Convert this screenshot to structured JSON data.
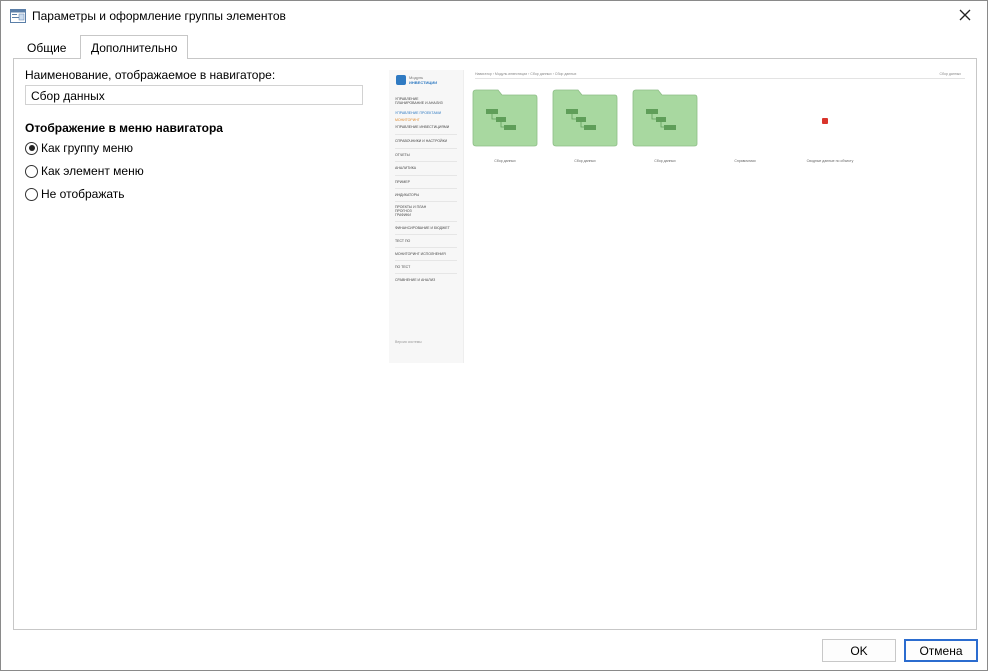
{
  "window": {
    "title": "Параметры и оформление группы элементов"
  },
  "tabs": [
    {
      "label": "Общие",
      "active": false
    },
    {
      "label": "Дополнительно",
      "active": true
    }
  ],
  "form": {
    "name_label": "Наименование, отображаемое в навигаторе:",
    "name_value": "Сбор данных",
    "section_title": "Отображение в меню навигатора",
    "options": [
      {
        "label": "Как группу меню",
        "checked": true
      },
      {
        "label": "Как элемент меню",
        "checked": false
      },
      {
        "label": "Не отображать",
        "checked": false
      }
    ]
  },
  "preview": {
    "logo_line1": "Модуль",
    "logo_line2": "ИНВЕСТИЦИИ",
    "sidebar_items": [
      "УПРАВЛЕНИЕ",
      "ПЛАНИРОВАНИЕ И АНАЛИЗ",
      "УПРАВЛЕНИЕ ПРОЕКТАМИ",
      "МОНИТОРИНГ",
      "УПРАВЛЕНИЕ ИНВЕСТИЦИЯМИ",
      "СПРАВОЧНИКИ И НАСТРОЙКИ",
      "ОТЧЕТЫ",
      "АНАЛИТИКА",
      "ПРИМЕР",
      "ИНДИКАТОРЫ",
      "ПРОЕКТЫ И ПЛАН",
      "ПРОГНОЗ",
      "ГРАФИКИ",
      "ФИНАНСИРОВАНИЕ И БЮДЖЕТ",
      "ТЕСТ ПО",
      "МОНИТОРИНГ ИСПОЛНЕНИЯ",
      "ПО ТЕСТ",
      "СРАВНЕНИЕ И АНАЛИЗ",
      "Версия системы"
    ],
    "breadcrumb": "Навигатор › Модуль инвестиции › Сбор данных › Сбор данных",
    "top_right": "Сбор данных",
    "tiles": [
      "Сбор данных",
      "Сбор данных",
      "Сбор данных"
    ],
    "extra_captions": [
      "Справочники",
      "Сводные данные по объекту"
    ]
  },
  "buttons": {
    "ok": "OK",
    "cancel": "Отмена"
  },
  "colors": {
    "folder": "#a8d8a0",
    "folder_dark": "#5f9e59",
    "accent": "#2b6ccf"
  }
}
